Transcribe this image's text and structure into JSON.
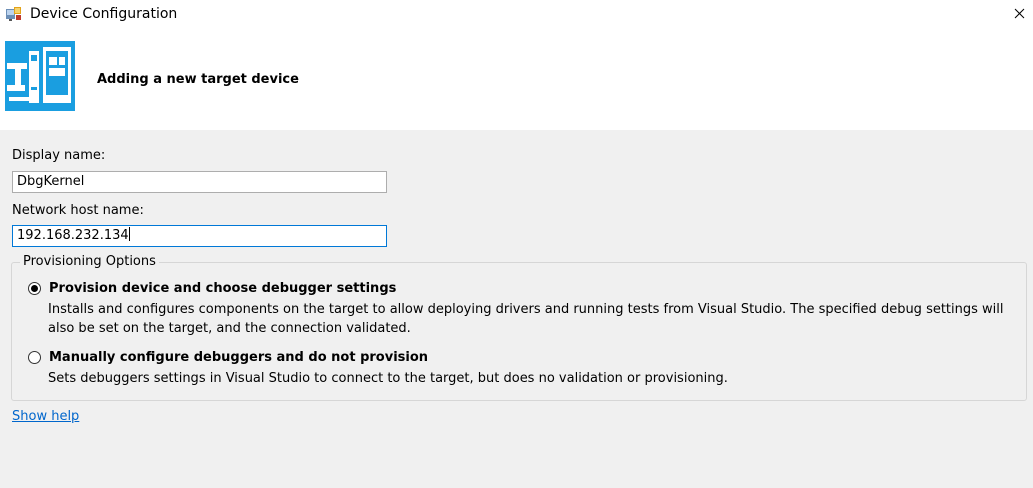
{
  "window": {
    "title": "Device Configuration",
    "icon": "app-config-icon",
    "close_icon": "close-icon"
  },
  "header": {
    "title": "Adding a new target device",
    "graphic": "devices-graphic-icon",
    "accent_color": "#1a9ee0"
  },
  "form": {
    "display_name_label": "Display name:",
    "display_name_value": "DbgKernel",
    "host_name_label": "Network host name:",
    "host_name_value": "192.168.232.134"
  },
  "provisioning": {
    "group_label": "Provisioning Options",
    "options": [
      {
        "title": "Provision device and choose debugger settings",
        "description": "Installs and configures components on the target to allow deploying drivers and running tests from Visual Studio. The specified debug settings will also be set on the target, and the connection validated.",
        "selected": true
      },
      {
        "title": "Manually configure debuggers and do not provision",
        "description": "Sets debuggers settings in Visual Studio to connect to the target, but does no validation or provisioning.",
        "selected": false
      }
    ]
  },
  "help": {
    "link_text": "Show help"
  }
}
